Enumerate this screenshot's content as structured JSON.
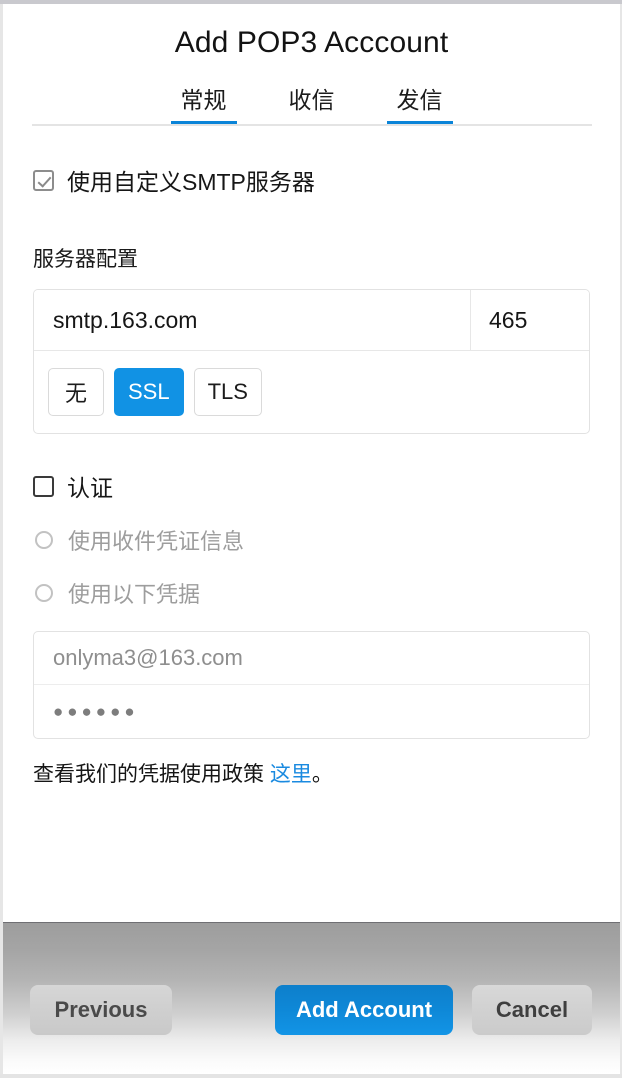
{
  "window": {
    "title": "Add POP3 Acccount"
  },
  "tabs": [
    {
      "label": "常规",
      "active": true
    },
    {
      "label": "收信",
      "active": false
    },
    {
      "label": "发信",
      "active": true
    }
  ],
  "smtp": {
    "use_custom_checkbox": {
      "label": "使用自定义SMTP服务器",
      "checked": true
    },
    "server_section_label": "服务器配置",
    "host": "smtp.163.com",
    "port": "465",
    "encryption_options": [
      "无",
      "SSL",
      "TLS"
    ],
    "encryption_selected": "SSL"
  },
  "auth": {
    "checkbox_label": "认证",
    "checkbox_checked": false,
    "radio_use_incoming": "使用收件凭证信息",
    "radio_use_following": "使用以下凭据",
    "username": "onlyma3@163.com",
    "password_mask": "●●●●●●",
    "policy_text": "查看我们的凭据使用政策 ",
    "policy_link": "这里",
    "policy_suffix": "。"
  },
  "footer": {
    "previous_label": "Previous",
    "add_account_label": "Add Account",
    "cancel_label": "Cancel"
  },
  "colors": {
    "accent": "#1192e4",
    "link": "#1a8ae0",
    "tab_underline": "#0a84d8"
  }
}
